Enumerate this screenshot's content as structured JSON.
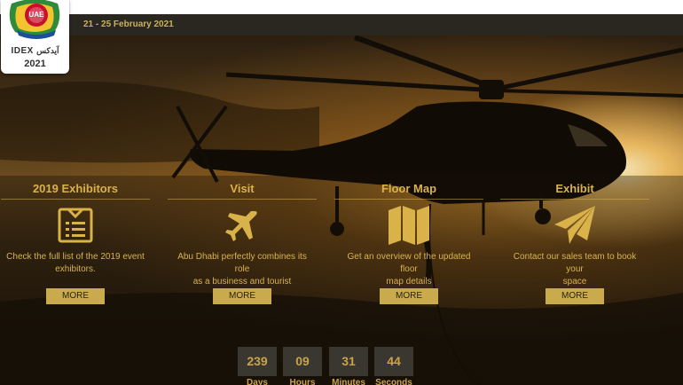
{
  "header": {
    "date_range": "21 - 25 February 2021"
  },
  "logo": {
    "badge": "UAE",
    "name": "IDEX",
    "name_arabic": "آيدكس",
    "year": "2021"
  },
  "cards": [
    {
      "title": "2019 Exhibitors",
      "icon": "exhibitor-list-icon",
      "description_line1": "Check the full list of the 2019 event",
      "description_line2": "exhibitors.",
      "button": "MORE"
    },
    {
      "title": "Visit",
      "icon": "airplane-icon",
      "description_line1": "Abu Dhabi perfectly combines its role",
      "description_line2": "as a business and tourist destination",
      "button": "MORE"
    },
    {
      "title": "Floor Map",
      "icon": "map-icon",
      "description_line1": "Get an overview of the updated floor",
      "description_line2": "map details",
      "button": "MORE"
    },
    {
      "title": "Exhibit",
      "icon": "paper-plane-icon",
      "description_line1": "Contact our sales team to book your",
      "description_line2": "space",
      "button": "MORE"
    }
  ],
  "countdown": [
    {
      "value": "239",
      "label": "Days"
    },
    {
      "value": "09",
      "label": "Hours"
    },
    {
      "value": "31",
      "label": "Minutes"
    },
    {
      "value": "44",
      "label": "Seconds"
    }
  ],
  "colors": {
    "accent_gold": "#d9b24a",
    "button_bg": "#c9ab4e",
    "date_bar": "#2a2620"
  }
}
